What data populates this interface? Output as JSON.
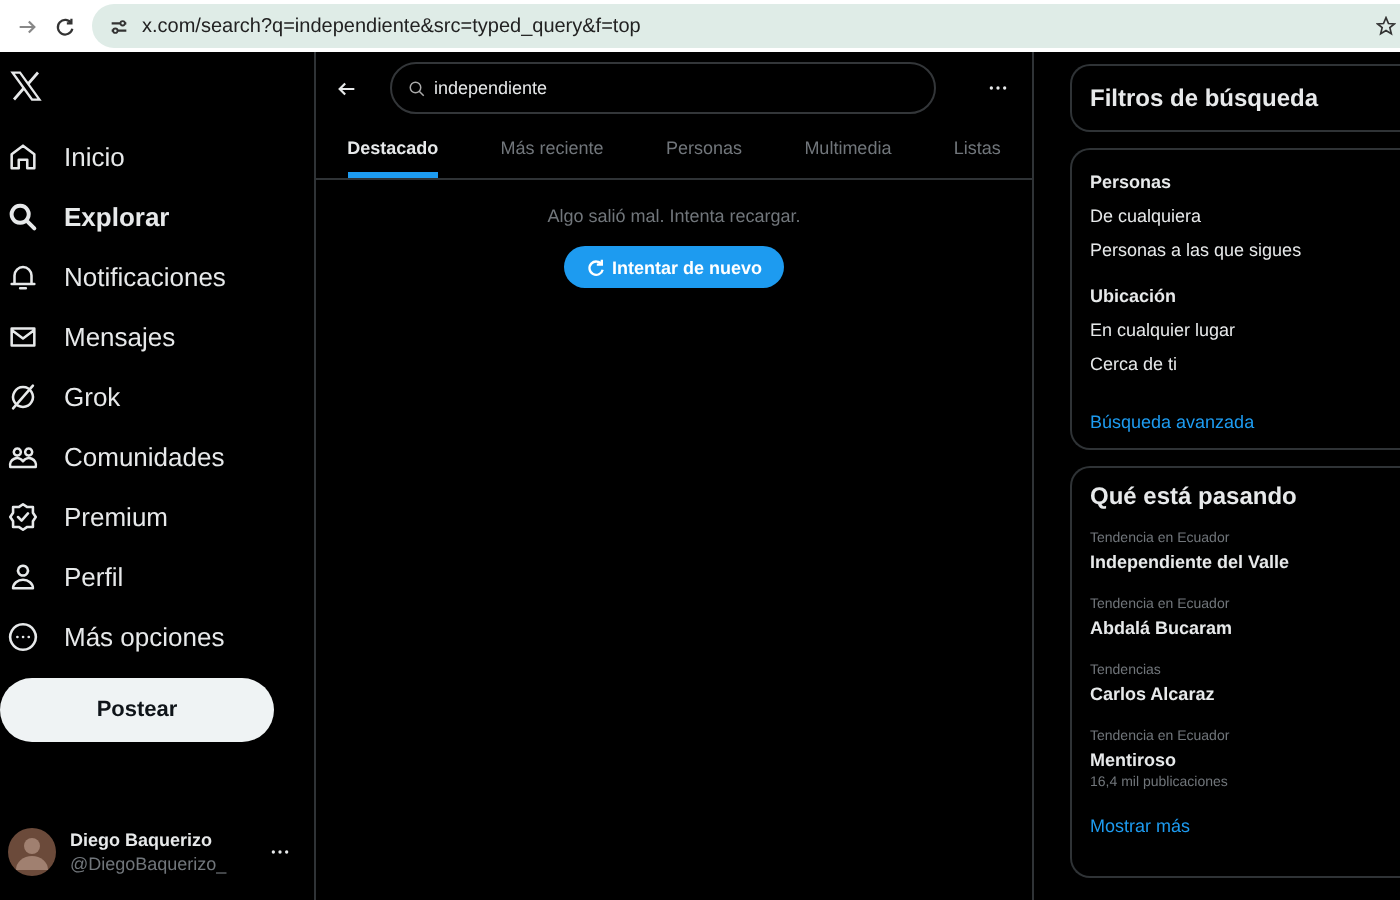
{
  "browser": {
    "url": "x.com/search?q=independiente&src=typed_query&f=top"
  },
  "sidebar": {
    "items": [
      {
        "label": "Inicio",
        "selected": false
      },
      {
        "label": "Explorar",
        "selected": true
      },
      {
        "label": "Notificaciones",
        "selected": false
      },
      {
        "label": "Mensajes",
        "selected": false
      },
      {
        "label": "Grok",
        "selected": false
      },
      {
        "label": "Comunidades",
        "selected": false
      },
      {
        "label": "Premium",
        "selected": false
      },
      {
        "label": "Perfil",
        "selected": false
      },
      {
        "label": "Más opciones",
        "selected": false
      }
    ],
    "post_button": "Postear",
    "account": {
      "name": "Diego Baquerizo",
      "handle": "@DiegoBaquerizo_"
    }
  },
  "search": {
    "value": "independiente"
  },
  "tabs": [
    {
      "label": "Destacado",
      "selected": true
    },
    {
      "label": "Más reciente",
      "selected": false
    },
    {
      "label": "Personas",
      "selected": false
    },
    {
      "label": "Multimedia",
      "selected": false
    },
    {
      "label": "Listas",
      "selected": false
    }
  ],
  "error": {
    "message": "Algo salió mal. Intenta recargar.",
    "retry_button": "Intentar de nuevo"
  },
  "filters": {
    "title": "Filtros de búsqueda",
    "groups": [
      {
        "heading": "Personas",
        "options": [
          "De cualquiera",
          "Personas a las que sigues"
        ]
      },
      {
        "heading": "Ubicación",
        "options": [
          "En cualquier lugar",
          "Cerca de ti"
        ]
      }
    ],
    "advanced_link": "Búsqueda avanzada"
  },
  "trends": {
    "title": "Qué está pasando",
    "items": [
      {
        "context": "Tendencia en Ecuador",
        "name": "Independiente del Valle"
      },
      {
        "context": "Tendencia en Ecuador",
        "name": "Abdalá Bucaram"
      },
      {
        "context": "Tendencias",
        "name": "Carlos Alcaraz"
      },
      {
        "context": "Tendencia en Ecuador",
        "name": "Mentiroso",
        "posts": "16,4 mil publicaciones"
      }
    ],
    "show_more": "Mostrar más"
  }
}
